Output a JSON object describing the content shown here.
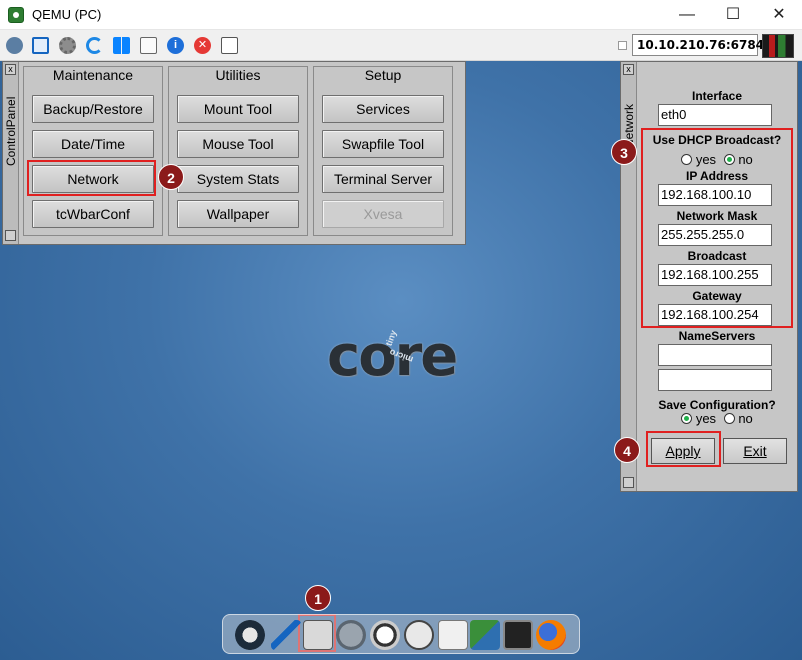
{
  "window": {
    "title": "QEMU (PC)",
    "minimize": "—",
    "maximize": "☐",
    "close": "✕"
  },
  "toolbar": {
    "address": "10.10.210.76:6784"
  },
  "control_panel": {
    "title": "ControlPanel",
    "close_glyph": "x",
    "columns": [
      {
        "heading": "Maintenance",
        "buttons": [
          "Backup/Restore",
          "Date/Time",
          "Network",
          "tcWbarConf"
        ]
      },
      {
        "heading": "Utilities",
        "buttons": [
          "Mount Tool",
          "Mouse Tool",
          "System Stats",
          "Wallpaper"
        ]
      },
      {
        "heading": "Setup",
        "buttons": [
          "Services",
          "Swapfile Tool",
          "Terminal Server",
          "Xvesa"
        ]
      }
    ]
  },
  "network_panel": {
    "title": "Network",
    "close_glyph": "x",
    "interface_label": "Interface",
    "interface_value": "eth0",
    "dhcp_label": "Use DHCP Broadcast?",
    "dhcp_yes": "yes",
    "dhcp_no": "no",
    "dhcp_selected": "no",
    "ip_label": "IP Address",
    "ip_value": "192.168.100.10",
    "mask_label": "Network Mask",
    "mask_value": "255.255.255.0",
    "broadcast_label": "Broadcast",
    "broadcast_value": "192.168.100.255",
    "gateway_label": "Gateway",
    "gateway_value": "192.168.100.254",
    "nameservers_label": "NameServers",
    "ns1_value": "",
    "ns2_value": "",
    "save_label": "Save Configuration?",
    "save_yes": "yes",
    "save_no": "no",
    "save_selected": "yes",
    "apply_label": "Apply",
    "exit_label": "Exit"
  },
  "desktop": {
    "logo_text": "core",
    "logo_small_1": "tiny",
    "logo_small_2": "micro"
  },
  "markers": [
    "1",
    "2",
    "3",
    "4"
  ],
  "dock": {
    "icons": [
      "power-icon",
      "editor-icon",
      "control-panel-icon",
      "mount-icon",
      "run-icon",
      "app-installer-icon",
      "text-editor-icon",
      "display-icon",
      "terminal-icon",
      "firefox-icon"
    ]
  },
  "colors": {
    "highlight": "#e02020",
    "marker_bg": "#8b1a1a",
    "desktop": "#3f72a8",
    "panel_bg": "#c6c6c6"
  }
}
